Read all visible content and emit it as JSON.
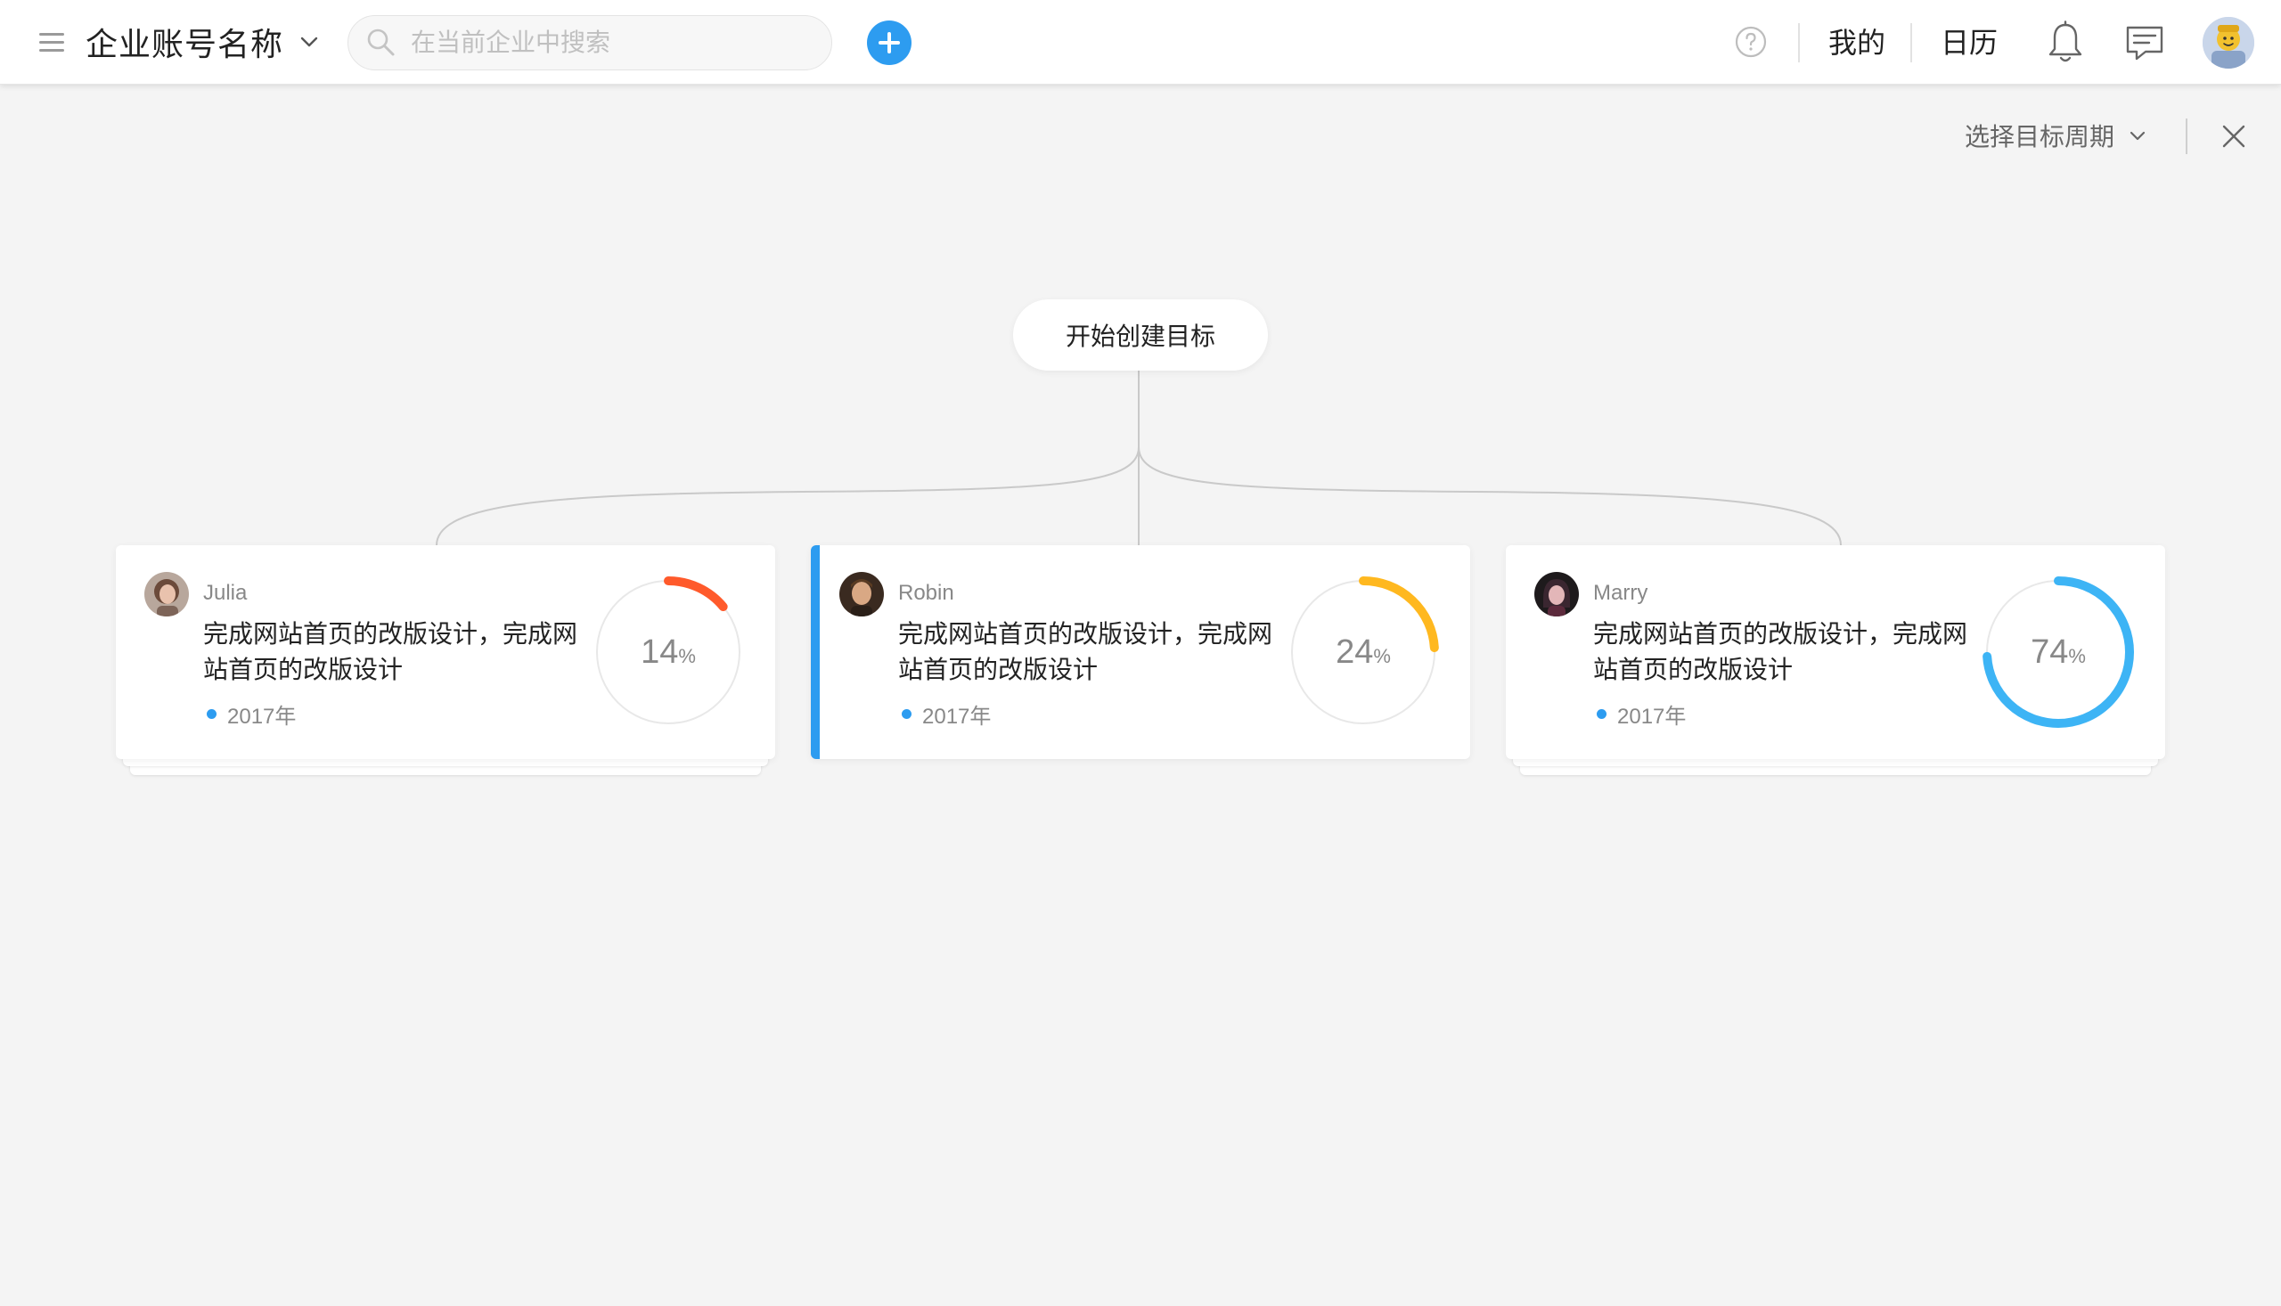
{
  "header": {
    "account_name": "企业账号名称",
    "search_placeholder": "在当前企业中搜索",
    "nav": {
      "mine": "我的",
      "calendar": "日历"
    },
    "icons": {
      "menu": "menu-icon",
      "account_dropdown": "chevron-down-icon",
      "search": "search-icon",
      "add": "plus-icon",
      "help": "help-icon",
      "notifications": "bell-icon",
      "messages": "message-icon",
      "user": "avatar"
    }
  },
  "toolbar": {
    "period_select_label": "选择目标周期",
    "icons": {
      "period_dropdown": "chevron-down-icon",
      "close": "close-icon"
    }
  },
  "tree": {
    "root_label": "开始创建目标",
    "cards": [
      {
        "owner": "Julia",
        "title": "完成网站首页的改版设计，完成网站首页的改版设计",
        "period": "2017年",
        "progress": 14,
        "progress_suffix": "%",
        "color": "#ff5a2b",
        "active": false
      },
      {
        "owner": "Robin",
        "title": "完成网站首页的改版设计，完成网站首页的改版设计",
        "period": "2017年",
        "progress": 24,
        "progress_suffix": "%",
        "color": "#ffb81f",
        "active": true
      },
      {
        "owner": "Marry",
        "title": "完成网站首页的改版设计，完成网站首页的改版设计",
        "period": "2017年",
        "progress": 74,
        "progress_suffix": "%",
        "color": "#3db4f5",
        "active": false
      }
    ]
  },
  "colors": {
    "accent": "#2d9cf0",
    "background": "#f4f4f4",
    "track": "#e8e8e8"
  }
}
